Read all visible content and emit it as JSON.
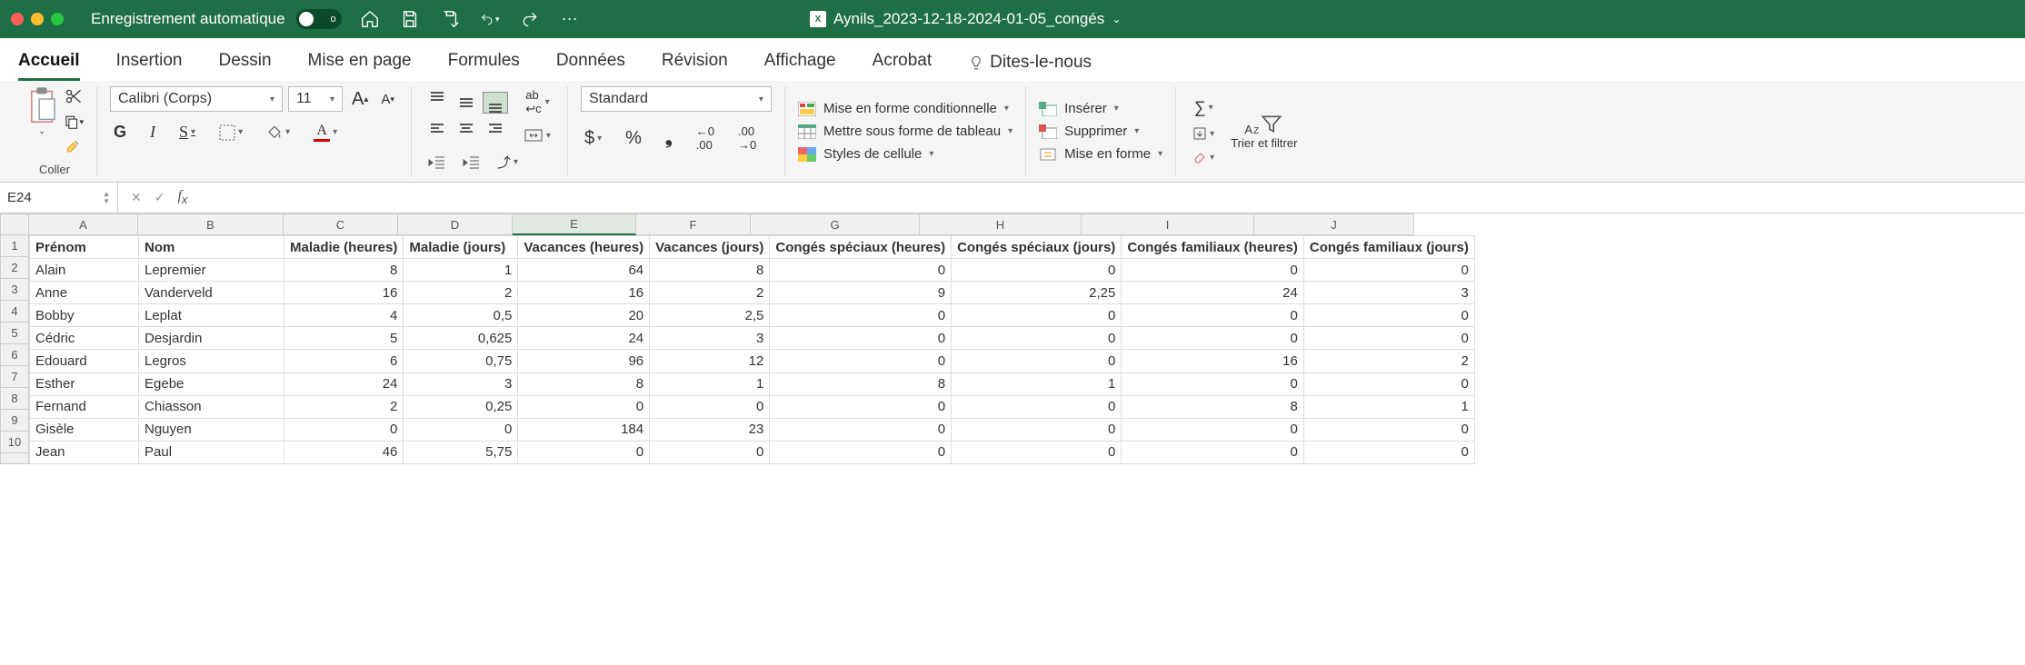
{
  "titlebar": {
    "autosave_label": "Enregistrement automatique",
    "toggle_state": "o",
    "doc_name": "Aynils_2023-12-18-2024-01-05_congés"
  },
  "tabs": {
    "home": "Accueil",
    "insert": "Insertion",
    "draw": "Dessin",
    "layout": "Mise en page",
    "formulas": "Formules",
    "data": "Données",
    "review": "Révision",
    "view": "Affichage",
    "acrobat": "Acrobat",
    "tellme": "Dites-le-nous"
  },
  "ribbon": {
    "paste": "Coller",
    "font_name": "Calibri (Corps)",
    "font_size": "11",
    "number_format": "Standard",
    "cond_format": "Mise en forme conditionnelle",
    "format_table": "Mettre sous forme de tableau",
    "cell_styles": "Styles de cellule",
    "insert": "Insérer",
    "delete": "Supprimer",
    "format": "Mise en forme",
    "sort_filter": "Trier et filtrer"
  },
  "formula_bar": {
    "name_box": "E24",
    "formula": ""
  },
  "columns": [
    "A",
    "B",
    "C",
    "D",
    "E",
    "F",
    "G",
    "H",
    "I",
    "J"
  ],
  "active_col": "E",
  "headers": [
    "Prénom",
    "Nom",
    "Maladie (heures)",
    "Maladie (jours)",
    "Vacances (heures)",
    "Vacances (jours)",
    "Congés spéciaux (heures)",
    "Congés spéciaux (jours)",
    "Congés familiaux (heures)",
    "Congés familiaux (jours)"
  ],
  "rows": [
    {
      "n": 1
    },
    {
      "n": 2,
      "d": [
        "Alain",
        "Lepremier",
        "8",
        "1",
        "64",
        "8",
        "0",
        "0",
        "0",
        "0"
      ]
    },
    {
      "n": 3,
      "d": [
        "Anne",
        "Vanderveld",
        "16",
        "2",
        "16",
        "2",
        "9",
        "2,25",
        "24",
        "3"
      ]
    },
    {
      "n": 4,
      "d": [
        "Bobby",
        "Leplat",
        "4",
        "0,5",
        "20",
        "2,5",
        "0",
        "0",
        "0",
        "0"
      ]
    },
    {
      "n": 5,
      "d": [
        "Cédric",
        "Desjardin",
        "5",
        "0,625",
        "24",
        "3",
        "0",
        "0",
        "0",
        "0"
      ]
    },
    {
      "n": 6,
      "d": [
        "Edouard",
        "Legros",
        "6",
        "0,75",
        "96",
        "12",
        "0",
        "0",
        "16",
        "2"
      ]
    },
    {
      "n": 7,
      "d": [
        "Esther",
        "Egebe",
        "24",
        "3",
        "8",
        "1",
        "8",
        "1",
        "0",
        "0"
      ]
    },
    {
      "n": 8,
      "d": [
        "Fernand",
        "Chiasson",
        "2",
        "0,25",
        "0",
        "0",
        "0",
        "0",
        "8",
        "1"
      ]
    },
    {
      "n": 9,
      "d": [
        "Gisèle",
        "Nguyen",
        "0",
        "0",
        "184",
        "23",
        "0",
        "0",
        "0",
        "0"
      ]
    },
    {
      "n": 10,
      "d": [
        "Jean",
        "Paul",
        "46",
        "5,75",
        "0",
        "0",
        "0",
        "0",
        "0",
        "0"
      ]
    }
  ]
}
